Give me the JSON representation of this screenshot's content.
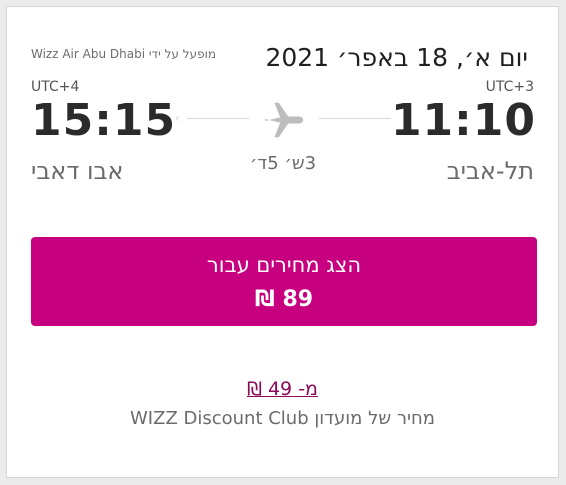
{
  "flight": {
    "date": "יום א׳, 18 באפר׳ 2021",
    "operated_by": "מופעל על ידי Wizz Air Abu Dhabi",
    "departure": {
      "timezone": "UTC+3",
      "time": "11:10",
      "city": "תל-אביב"
    },
    "arrival": {
      "timezone": "UTC+4",
      "time": "15:15",
      "city": "אבו דאבי"
    },
    "duration": "3ש׳ 5ד׳",
    "plane_icon": "airplane-icon",
    "arrow_icon": "arrow-left-icon"
  },
  "price_button": {
    "label": "הצג מחירים עבור",
    "price": "89 ₪"
  },
  "club": {
    "link_text": "מ- 49 ₪",
    "note": "מחיר של מועדון WIZZ Discount Club"
  },
  "colors": {
    "accent": "#c6007e",
    "link": "#8a0a58",
    "text_dark": "#2b2b2b",
    "text_muted": "#6b6b6b"
  }
}
